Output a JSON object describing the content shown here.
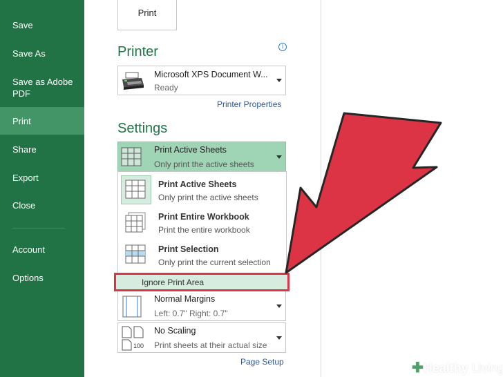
{
  "sidebar": {
    "items": [
      {
        "label": "Save"
      },
      {
        "label": "Save As"
      },
      {
        "label": "Save as Adobe PDF"
      },
      {
        "label": "Print"
      },
      {
        "label": "Share"
      },
      {
        "label": "Export"
      },
      {
        "label": "Close"
      },
      {
        "label": "Account"
      },
      {
        "label": "Options"
      }
    ]
  },
  "print_button": {
    "label": "Print"
  },
  "printer": {
    "section_title": "Printer",
    "info_glyph": "i",
    "name": "Microsoft XPS Document W...",
    "status": "Ready",
    "properties_link": "Printer Properties"
  },
  "settings": {
    "section_title": "Settings",
    "scope": {
      "title": "Print Active Sheets",
      "subtitle": "Only print the active sheets"
    },
    "menu": [
      {
        "title": "Print Active Sheets",
        "subtitle": "Only print the active sheets"
      },
      {
        "title": "Print Entire Workbook",
        "subtitle": "Print the entire workbook"
      },
      {
        "title": "Print Selection",
        "subtitle": "Only print the current selection"
      }
    ],
    "ignore_print_area": "Ignore Print Area",
    "margins": {
      "title": "Normal Margins",
      "subtitle": "Left: 0.7\"   Right: 0.7\""
    },
    "scaling": {
      "title": "No Scaling",
      "subtitle": "Print sheets at their actual size",
      "icon_text": "100"
    },
    "page_setup_link": "Page Setup"
  },
  "watermark": {
    "bold": "Healthy",
    "thin": " Living"
  },
  "colors": {
    "sidebar": "#217346",
    "active": "#439467",
    "accent": "#217346",
    "arrow": "#dc3444",
    "link": "#2b5797"
  },
  "icons": [
    "printer-icon",
    "sheet-icon",
    "info-icon",
    "chevron-down-icon",
    "red-arrow-annotation"
  ]
}
